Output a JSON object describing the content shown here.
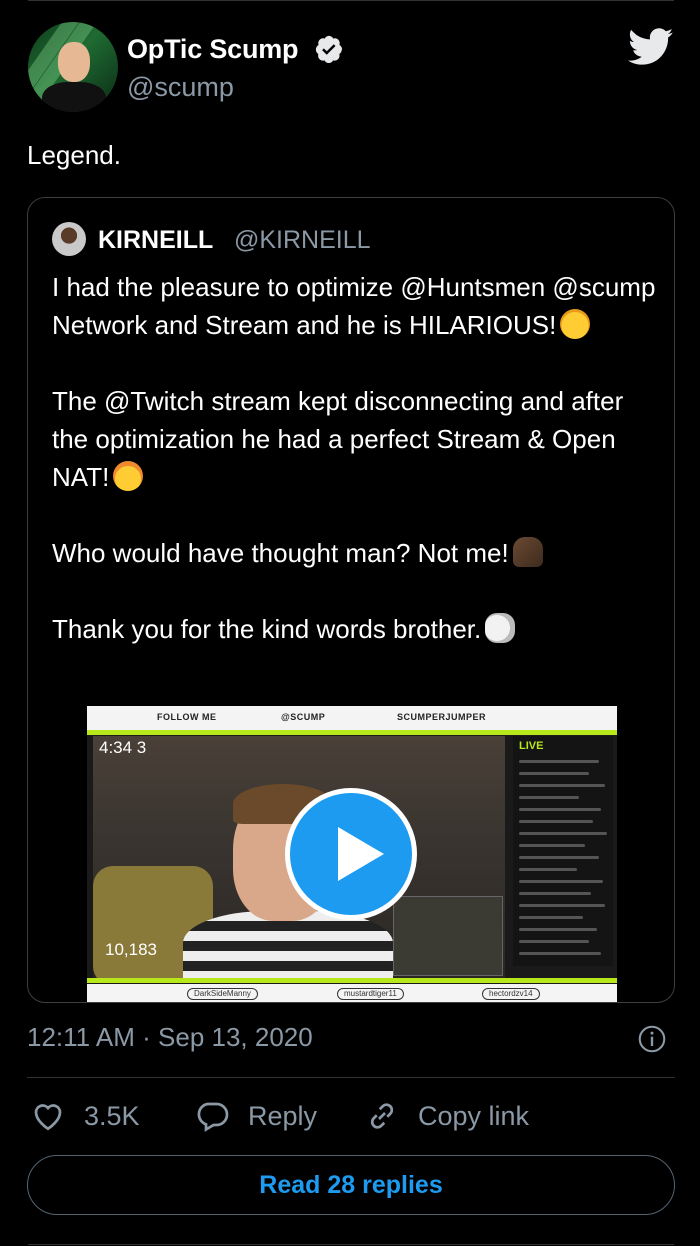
{
  "tweet": {
    "author_name": "OpTic Scump",
    "author_handle": "@scump",
    "text": "Legend.",
    "timestamp": "12:11 AM · Sep 13, 2020"
  },
  "quoted_tweet": {
    "author_name": "KIRNEILL",
    "author_handle": "@KIRNEILL",
    "paragraphs": [
      "I had the pleasure to optimize @Huntsmen @scump Network and Stream and he is HILARIOUS!",
      "The @Twitch stream kept disconnecting and after the optimization he had a perfect Stream & Open NAT!",
      "Who would have thought man? Not me!",
      "Thank you for the kind words brother."
    ],
    "video": {
      "top_labels": [
        "FOLLOW ME",
        "@SCUMP",
        "SCUMPERJUMPER"
      ],
      "timer": "4:34   3",
      "views": "10,183",
      "chat_live": "LIVE",
      "bottom_labels": [
        "DarkSideManny",
        "mustardtiger11",
        "hectordzv14"
      ]
    }
  },
  "actions": {
    "likes": "3.5K",
    "reply": "Reply",
    "copy_link": "Copy link",
    "read_replies": "Read 28 replies"
  },
  "colors": {
    "background": "#000000",
    "accent": "#1d9bf0",
    "muted_text": "#8b98a5",
    "border": "#2f3336"
  },
  "icons": [
    "twitter-logo-icon",
    "verified-badge-icon",
    "info-icon",
    "heart-icon",
    "reply-bubble-icon",
    "link-icon",
    "play-icon"
  ]
}
